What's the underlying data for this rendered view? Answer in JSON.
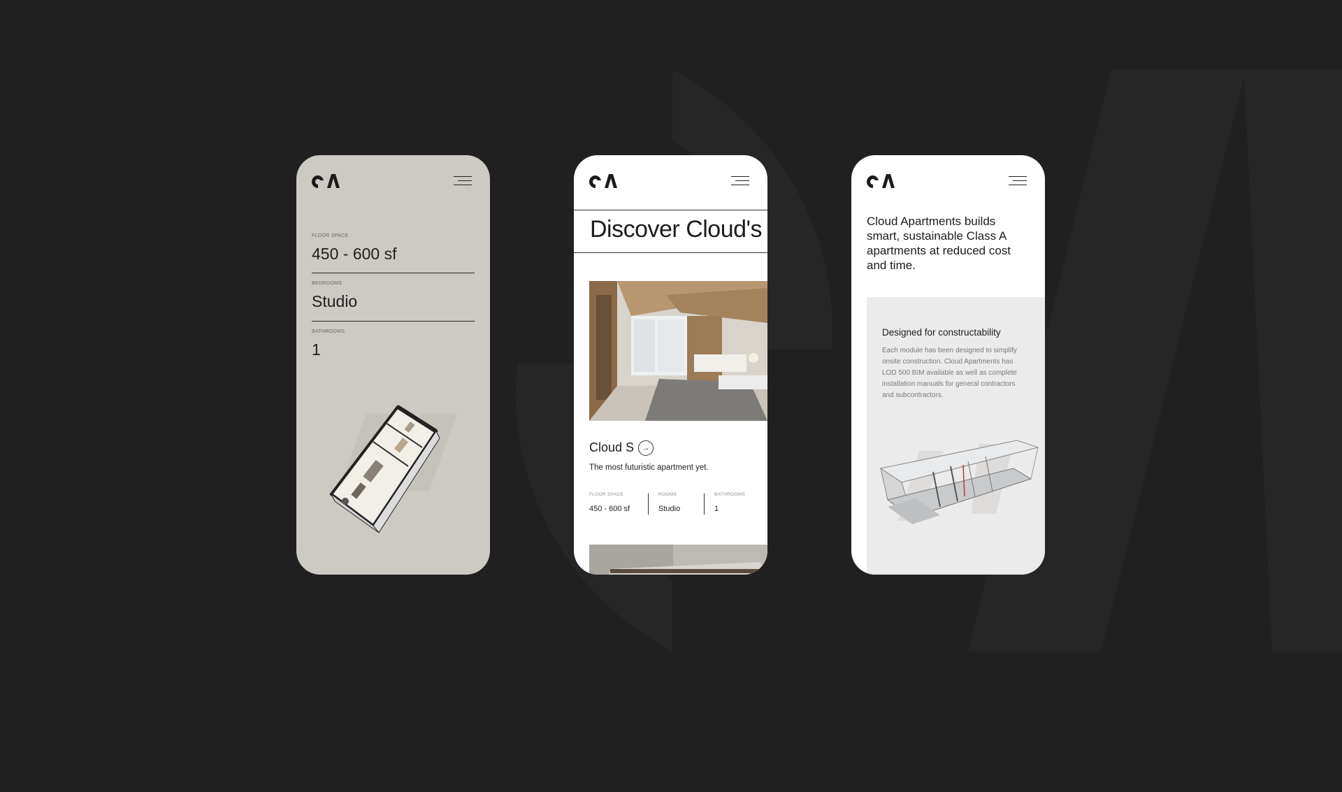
{
  "colors": {
    "page_background": "#202020",
    "phone1_background": "#cdcac4",
    "feature_panel": "#ebebeb",
    "ink": "#1c1c1c"
  },
  "icons": [
    "brand-logo-icon",
    "hamburger-menu-icon",
    "arrow-right-icon"
  ],
  "phone1": {
    "floor_space_label": "FLOOR SPACE",
    "floor_space_value": "450 - 600 sf",
    "bedrooms_label": "BEDROOMS",
    "bedrooms_value": "Studio",
    "bathrooms_label": "BATHROOMS",
    "bathrooms_value": "1"
  },
  "phone2": {
    "title": "Discover Cloud's",
    "model_name": "Cloud S",
    "model_description": "The most futuristic apartment yet.",
    "specs": [
      {
        "label": "FLOOR SPACE",
        "value": "450 - 600 sf"
      },
      {
        "label": "ROOMS",
        "value": "Studio"
      },
      {
        "label": "BATHROOMS",
        "value": "1"
      }
    ]
  },
  "phone3": {
    "intro": "Cloud Apartments builds smart, sustainable Class A apartments at reduced cost and time.",
    "feature_title": "Designed for constructability",
    "feature_text": "Each module has been designed to simplify onsite construction. Cloud Apartments has LOD 500 BIM available as well as complete installation manuals for general contractors and subcontractors."
  }
}
